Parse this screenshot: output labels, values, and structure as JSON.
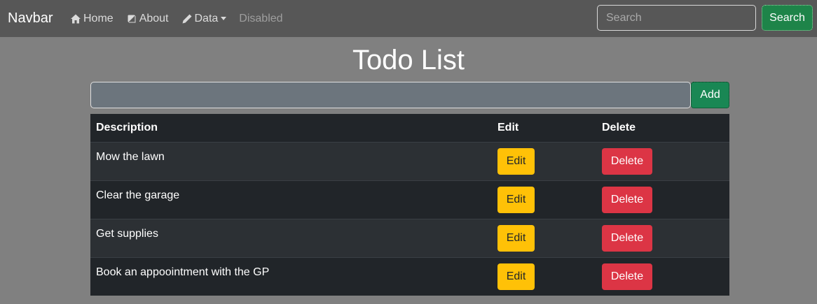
{
  "navbar": {
    "brand": "Navbar",
    "links": [
      {
        "label": "Home",
        "icon": "home-icon"
      },
      {
        "label": "About",
        "icon": "book-icon"
      },
      {
        "label": "Data",
        "icon": "pencil-icon",
        "dropdown": true
      },
      {
        "label": "Disabled",
        "disabled": true
      }
    ],
    "search": {
      "placeholder": "Search",
      "value": ""
    },
    "search_button": "Search"
  },
  "page": {
    "title": "Todo List"
  },
  "add_form": {
    "input_value": "",
    "add_button": "Add"
  },
  "table": {
    "headers": [
      "Description",
      "Edit",
      "Delete"
    ],
    "rows": [
      {
        "description": "Mow the lawn",
        "edit": "Edit",
        "delete": "Delete"
      },
      {
        "description": "Clear the garage",
        "edit": "Edit",
        "delete": "Delete"
      },
      {
        "description": "Get supplies",
        "edit": "Edit",
        "delete": "Delete"
      },
      {
        "description": "Book an appoointment with the GP",
        "edit": "Edit",
        "delete": "Delete"
      }
    ]
  },
  "colors": {
    "navbar_bg": "#575757",
    "page_bg": "#808080",
    "success": "#198754",
    "warning": "#ffc107",
    "danger": "#dc3545",
    "table_dark": "#212529"
  }
}
